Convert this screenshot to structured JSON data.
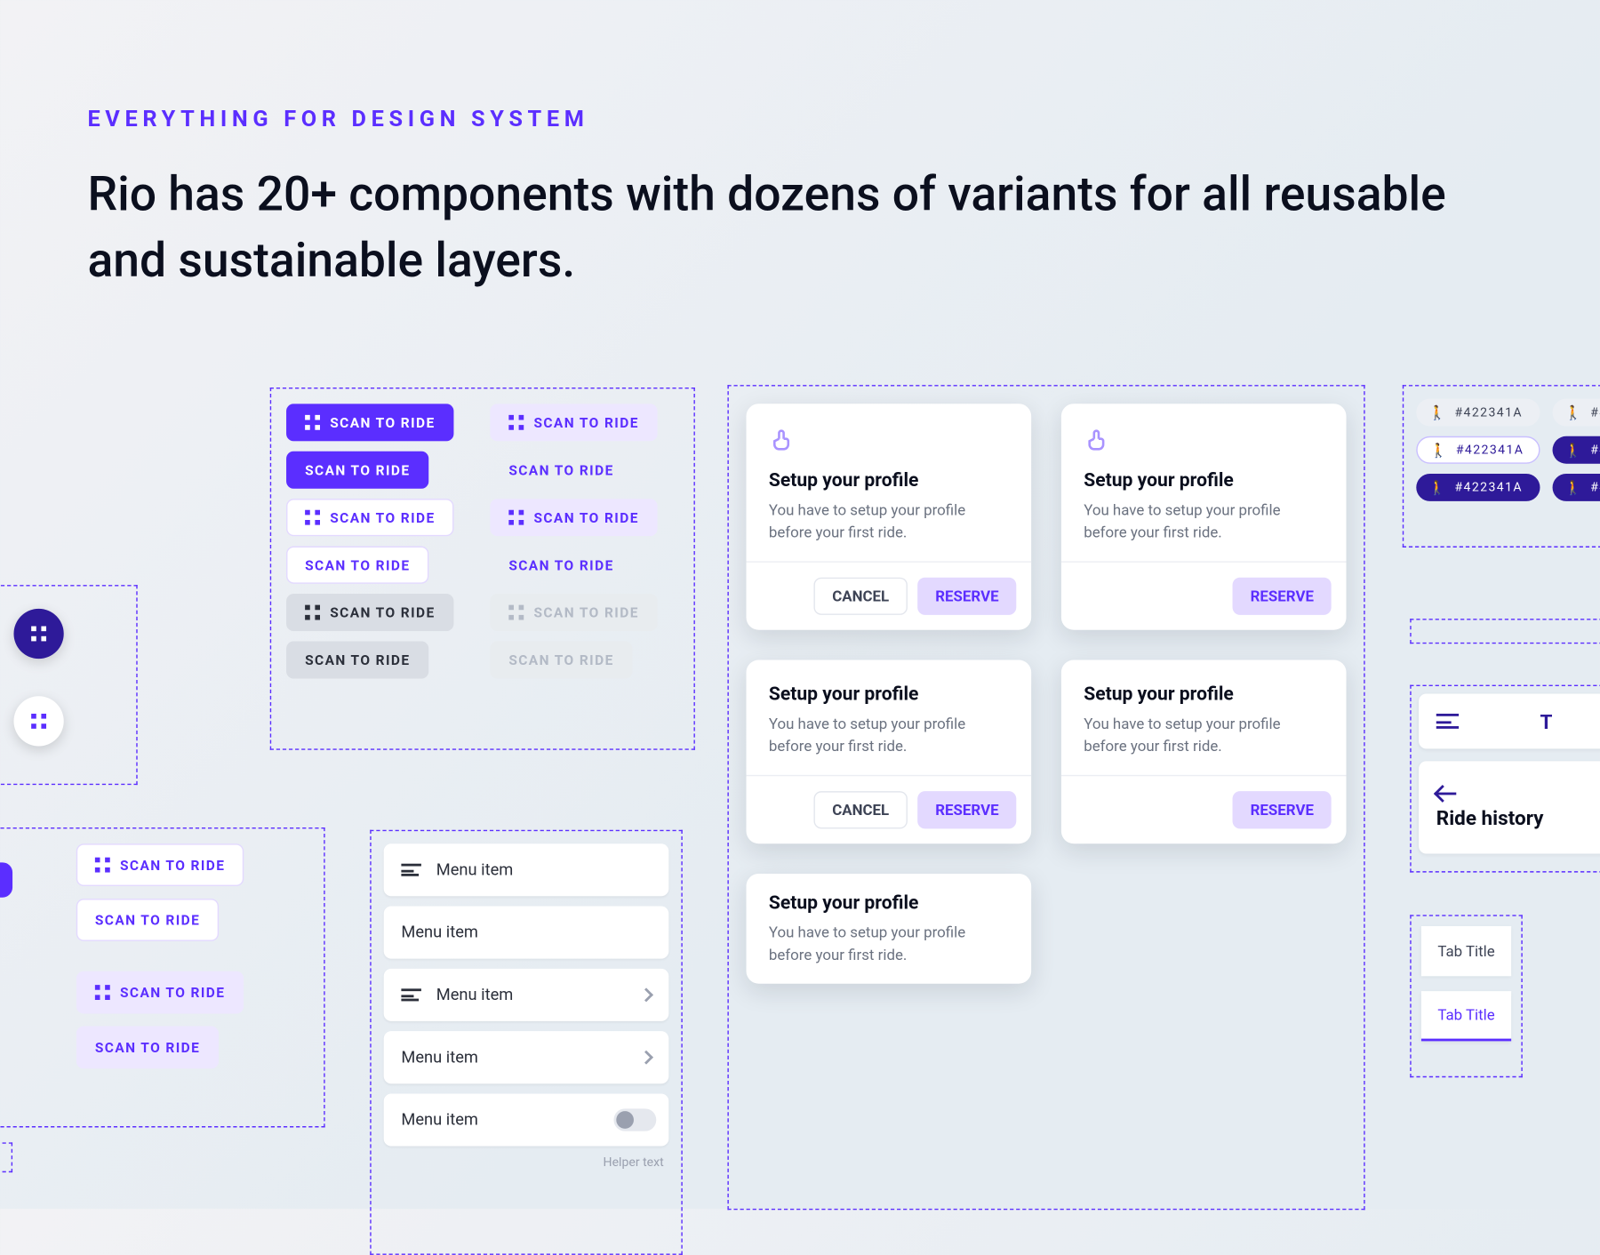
{
  "header": {
    "eyebrow": "EVERYTHING FOR DESIGN SYSTEM",
    "headline": "Rio has 20+ components with dozens of variants for all reusable and sustainable layers."
  },
  "buttons": {
    "label": "SCAN TO RIDE"
  },
  "menu": {
    "item_label": "Menu item",
    "helper": "Helper text"
  },
  "card": {
    "title": "Setup your profile",
    "description": "You have to setup your profile before your first ride.",
    "cancel": "CANCEL",
    "reserve": "RESERVE"
  },
  "chip": {
    "code": "#422341A",
    "code_short": "#422"
  },
  "nav": {
    "ride_history": "Ride history",
    "letter": "T"
  },
  "tabs": {
    "inactive": "Tab Title",
    "active": "Tab Title"
  },
  "colors": {
    "primary": "#5B2EFF",
    "deep": "#2E1A99",
    "light": "#E3D9FF"
  }
}
